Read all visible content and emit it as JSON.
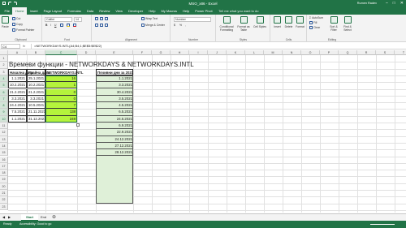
{
  "window": {
    "title": "MSO_x86 - Excel",
    "user": "Rumen Radev"
  },
  "tabs": [
    "File",
    "Home",
    "Insert",
    "Page Layout",
    "Formulas",
    "Data",
    "Review",
    "View",
    "Developer",
    "Help",
    "My Macros",
    "Help",
    "Power Pivot"
  ],
  "tell_me": "Tell me what you want to do",
  "ribbon": {
    "clipboard": {
      "label": "Clipboard",
      "paste": "Paste",
      "cut": "Cut",
      "copy": "Copy",
      "format_painter": "Format Painter"
    },
    "font": {
      "label": "Font",
      "font_name": "Calibri",
      "font_size": "14"
    },
    "alignment": {
      "label": "Alignment",
      "wrap_text": "Wrap Text",
      "merge_center": "Merge & Center"
    },
    "number": {
      "label": "Number",
      "format": "Number"
    },
    "styles": {
      "label": "Styles",
      "conditional": "Conditional Formatting",
      "format_table": "Format as Table",
      "cell_styles": "Cell Styles"
    },
    "cells": {
      "label": "Cells",
      "insert": "Insert",
      "delete": "Delete",
      "format": "Format"
    },
    "editing": {
      "label": "Editing",
      "autosum": "AutoSum",
      "fill": "Fill",
      "clear": "Clear",
      "sort_filter": "Sort & Filter",
      "find_select": "Find & Select"
    }
  },
  "formula_bar": {
    "name_box": "C4",
    "fx": "fx",
    "formula": "=NETWORKDAYS.INTL(A4;B4;1;$E$5:$E$22)"
  },
  "columns": [
    "A",
    "B",
    "C",
    "D",
    "E",
    "F",
    "G",
    "H",
    "I",
    "J",
    "K",
    "L",
    "M",
    "N",
    "O",
    "P",
    "Q",
    "R",
    "S",
    "T"
  ],
  "rows": [
    "1",
    "2",
    "3",
    "4",
    "5",
    "6",
    "7",
    "8",
    "9",
    "10",
    "11",
    "12",
    "13",
    "14",
    "15",
    "16",
    "17",
    "18",
    "19",
    "20",
    "21",
    "22",
    "23"
  ],
  "sheet": {
    "title": "Времеви функции - NETWORKDAYS & NETWORKDAYS.INTL",
    "headers": {
      "start": "Начална дата",
      "end": "Крайна дата",
      "func": "NETWORKDAYS.INTL",
      "holidays": "Почивни дни за 2021"
    },
    "table": [
      {
        "start": "1.1.2021",
        "end": "25.1.2021",
        "value": "16"
      },
      {
        "start": "10.2.2021",
        "end": "10.2.2021",
        "value": "1"
      },
      {
        "start": "21.2.2021",
        "end": "21.2.2021",
        "value": "0"
      },
      {
        "start": "3.3.2021",
        "end": "3.3.2021",
        "value": "0"
      },
      {
        "start": "24.4.2021",
        "end": "10.5.2021",
        "value": "7"
      },
      {
        "start": "7.5.2021",
        "end": "21.11.2021",
        "value": "138"
      },
      {
        "start": "1.1.2021",
        "end": "31.12.2021",
        "value": "249"
      }
    ],
    "holidays": [
      "1.1.2021",
      "3.3.2021",
      "30.4.2021",
      "3.5.2021",
      "4.5.2021",
      "6.5.2021",
      "24.5.2021",
      "6.9.2021",
      "22.9.2021",
      "24.12.2021",
      "27.12.2021",
      "28.12.2021"
    ]
  },
  "sheet_tabs": [
    "Start",
    "End"
  ],
  "status": {
    "mode": "Ready",
    "accessibility": "Accessibility: Good to go"
  }
}
